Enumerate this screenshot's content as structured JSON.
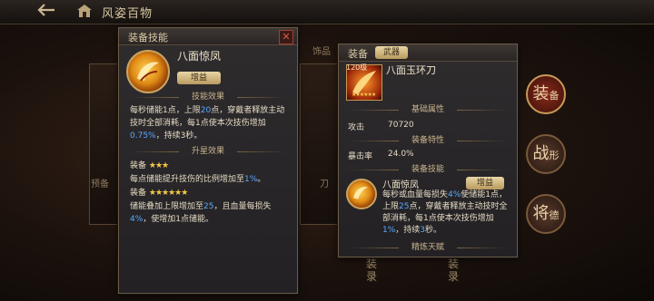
{
  "topbar": {
    "title": "风姿百物"
  },
  "background": {
    "tab_label": "饰品",
    "left_card_text": "预备",
    "right_card_text": "刀",
    "vertical_left": "装录",
    "vertical_right": "装录"
  },
  "side_nav": [
    {
      "label": "装",
      "sub": "备",
      "active": true
    },
    {
      "label": "战",
      "sub": "形",
      "active": false
    },
    {
      "label": "将",
      "sub": "德",
      "active": false
    }
  ],
  "skill_panel": {
    "header": "装备技能",
    "close": "✕",
    "skill_name": "八面惊凤",
    "tag": "增益",
    "section_effect": "技能效果",
    "effect_parts": [
      {
        "t": "每秒储能1点，上限",
        "h": false
      },
      {
        "t": "20",
        "h": true
      },
      {
        "t": "点，穿戴者释放主动技时全部消耗，每1点使本次技伤增加",
        "h": false
      },
      {
        "t": "0.75%",
        "h": true
      },
      {
        "t": "，持续3秒。",
        "h": false
      }
    ],
    "section_upgrade": "升星效果",
    "upgrade1_label": "装备",
    "upgrade1_stars": "★★★",
    "upgrade1_parts": [
      {
        "t": "每点储能提升技伤的比例增加至",
        "h": false
      },
      {
        "t": "1%",
        "h": true
      },
      {
        "t": "。",
        "h": false
      }
    ],
    "upgrade2_label": "装备",
    "upgrade2_stars": "★★★★★★",
    "upgrade2_parts": [
      {
        "t": "储能叠加上限增加至",
        "h": false
      },
      {
        "t": "25",
        "h": true
      },
      {
        "t": "，且血量每损失",
        "h": false
      },
      {
        "t": "4%",
        "h": true
      },
      {
        "t": "，使增加1点储能。",
        "h": false
      }
    ]
  },
  "equip_panel": {
    "header": "装备",
    "header_tag": "武器",
    "level": "120级",
    "weapon_name": "八面玉环刀",
    "stars": "★★★★★★",
    "section_base": "基础属性",
    "attack_label": "攻击",
    "attack_value": "70720",
    "section_trait": "装备特性",
    "crit_label": "暴击率",
    "crit_value": "24.0%",
    "section_skill": "装备技能",
    "skill_name": "八面惊凤",
    "skill_tag": "增益",
    "skill_parts": [
      {
        "t": "每秒或血量每损失",
        "h": false
      },
      {
        "t": "4%",
        "h": true
      },
      {
        "t": "使储能1点，上限",
        "h": false
      },
      {
        "t": "25",
        "h": true
      },
      {
        "t": "点，穿戴者释放主动技时全部消耗，每1点使本次技伤增加",
        "h": false
      },
      {
        "t": "1%",
        "h": true
      },
      {
        "t": "，持续",
        "h": false
      },
      {
        "t": "3",
        "h": true
      },
      {
        "t": "秒。",
        "h": false
      }
    ],
    "section_talent": "精炼天赋"
  },
  "colors": {
    "highlight": "#5aa8ff",
    "star": "#f5c84a",
    "accent": "#c89a58"
  }
}
